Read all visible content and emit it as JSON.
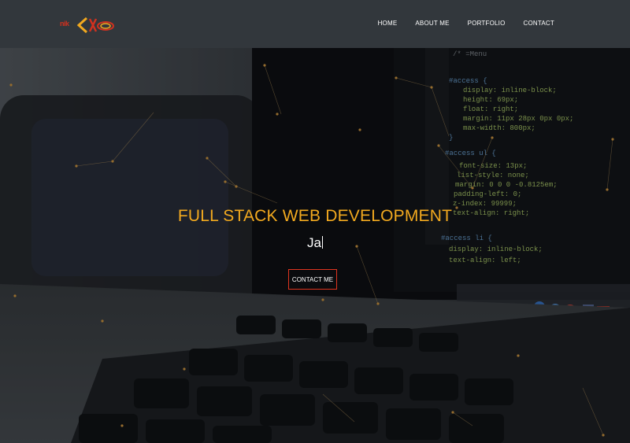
{
  "header": {
    "logo_text": "nik",
    "nav": {
      "home": "HOME",
      "about": "ABOUT ME",
      "portfolio": "PORTFOLIO",
      "contact": "CONTACT"
    }
  },
  "hero": {
    "title": "FULL STACK WEB DEVELOPMENT",
    "typed_text": "Ja",
    "cta_label": "CONTACT ME"
  },
  "code_lines": [
    "/* =Menu",
    "#access {",
    "display: inline-block;",
    "height: 69px;",
    "float: right;",
    "margin: 11px 28px 0px 0px;",
    "max-width: 800px;",
    "}",
    "#access ul {",
    "font-size: 13px;",
    "list-style: none;",
    "margin: 0 0 0 -0.8125em;",
    "padding-left: 0;",
    "z-index: 99999;",
    "text-align: right;",
    "#access li {",
    "display: inline-block;",
    "text-align: left;"
  ],
  "colors": {
    "header_bg": "#32373c",
    "accent_orange": "#f2a91f",
    "accent_red": "#e0341f"
  }
}
